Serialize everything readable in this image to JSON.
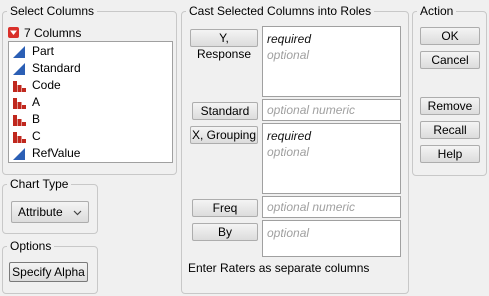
{
  "select_columns": {
    "title": "Select Columns",
    "count_label": "7 Columns",
    "columns": [
      {
        "name": "Part",
        "type": "continuous"
      },
      {
        "name": "Standard",
        "type": "continuous"
      },
      {
        "name": "Code",
        "type": "nominal"
      },
      {
        "name": "A",
        "type": "nominal"
      },
      {
        "name": "B",
        "type": "nominal"
      },
      {
        "name": "C",
        "type": "nominal"
      },
      {
        "name": "RefValue",
        "type": "continuous"
      }
    ]
  },
  "chart_type": {
    "title": "Chart Type",
    "selected": "Attribute"
  },
  "options": {
    "title": "Options",
    "specify_alpha": "Specify Alpha"
  },
  "cast": {
    "title": "Cast Selected Columns into Roles",
    "roles": {
      "y_response": {
        "label": "Y, Response",
        "lines": [
          "required",
          "optional"
        ]
      },
      "standard": {
        "label": "Standard",
        "placeholder": "optional numeric"
      },
      "x_grouping": {
        "label": "X, Grouping",
        "lines": [
          "required",
          "optional"
        ]
      },
      "freq": {
        "label": "Freq",
        "placeholder": "optional numeric"
      },
      "by": {
        "label": "By",
        "placeholder": "optional"
      }
    },
    "note": "Enter Raters as separate columns"
  },
  "action": {
    "title": "Action",
    "ok": "OK",
    "cancel": "Cancel",
    "remove": "Remove",
    "recall": "Recall",
    "help": "Help"
  },
  "colors": {
    "continuous": "#2b5fb5",
    "nominal": "#c0281e",
    "collapse": "#d9302a"
  }
}
